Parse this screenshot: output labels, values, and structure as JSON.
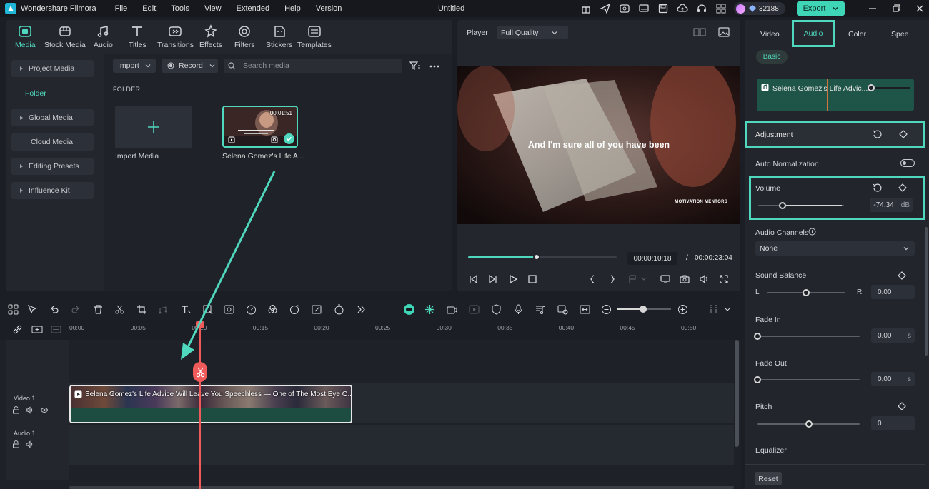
{
  "app": {
    "name": "Wondershare Filmora",
    "document_title": "Untitled",
    "menu": [
      "File",
      "Edit",
      "Tools",
      "View",
      "Extended",
      "Help",
      "Version"
    ],
    "credits": "32188",
    "export_label": "Export"
  },
  "media_tabs": [
    {
      "label": "Media",
      "icon": "media-icon"
    },
    {
      "label": "Stock Media",
      "icon": "stock-media-icon"
    },
    {
      "label": "Audio",
      "icon": "music-note-icon"
    },
    {
      "label": "Titles",
      "icon": "text-t-icon"
    },
    {
      "label": "Transitions",
      "icon": "transitions-icon"
    },
    {
      "label": "Effects",
      "icon": "effects-icon"
    },
    {
      "label": "Filters",
      "icon": "filters-icon"
    },
    {
      "label": "Stickers",
      "icon": "stickers-icon"
    },
    {
      "label": "Templates",
      "icon": "templates-icon"
    }
  ],
  "sidebar": {
    "project_media": "Project Media",
    "folder": "Folder",
    "global_media": "Global Media",
    "cloud_media": "Cloud Media",
    "editing_presets": "Editing Presets",
    "influence_kit": "Influence Kit"
  },
  "media_toolbar": {
    "import_label": "Import",
    "record_label": "Record",
    "search_placeholder": "Search media"
  },
  "media_grid": {
    "folder_heading": "FOLDER",
    "import_tile_label": "Import Media",
    "clip": {
      "name": "Selena Gomez's Life A...",
      "duration": "00:01:51"
    }
  },
  "player": {
    "label": "Player",
    "quality": "Full Quality",
    "subtitle": "And I'm sure all of you have been",
    "watermark": "MOTIVATION MENTORS",
    "current_time": "00:00:10:18",
    "separator": "/",
    "total_time": "00:00:23:04",
    "progress_fraction": 0.46
  },
  "properties": {
    "tabs": {
      "video": "Video",
      "audio": "Audio",
      "color": "Color",
      "speed": "Spee"
    },
    "basic_label": "Basic",
    "audio_clip_name": "Selena Gomez's Life Advic...",
    "adjustment_label": "Adjustment",
    "auto_normalization_label": "Auto Normalization",
    "volume": {
      "label": "Volume",
      "value": "-74.34",
      "unit": "dB",
      "fraction": 0.28
    },
    "audio_channels": {
      "label": "Audio Channels",
      "value": "None"
    },
    "sound_balance": {
      "label": "Sound Balance",
      "left": "L",
      "right": "R",
      "value": "0.00",
      "fraction": 0.5
    },
    "fade_in": {
      "label": "Fade In",
      "value": "0.00",
      "unit": "s",
      "fraction": 0
    },
    "fade_out": {
      "label": "Fade Out",
      "value": "0.00",
      "unit": "s",
      "fraction": 0
    },
    "pitch": {
      "label": "Pitch",
      "value": "0",
      "fraction": 0.5
    },
    "equalizer_label": "Equalizer",
    "reset_label": "Reset"
  },
  "timeline": {
    "ruler_ticks": [
      "00:00",
      "00:05",
      "00:10",
      "00:15",
      "00:20",
      "00:25",
      "00:30",
      "00:35",
      "00:40",
      "00:45",
      "00:50"
    ],
    "video_track_label": "Video 1",
    "audio_track_label": "Audio 1",
    "clip_title": "Selena Gomez's Life Advice Will Leave You Speechless — One of The Most Eye O..."
  },
  "colors": {
    "accent": "#4fd8bd",
    "playhead": "#f05a5a",
    "background": "#1b1e24"
  }
}
